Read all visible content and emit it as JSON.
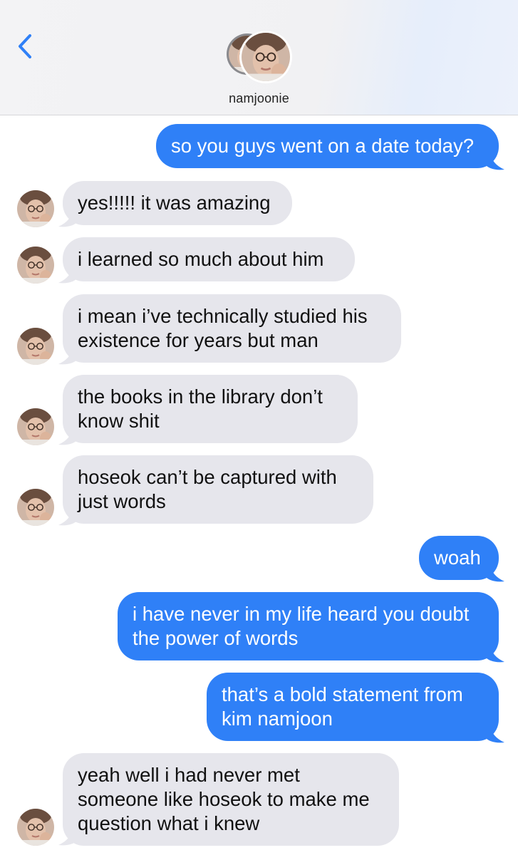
{
  "header": {
    "contact_name": "namjoonie",
    "back_icon": "chevron-left-icon",
    "accent_color": "#2f80f7"
  },
  "messages": [
    {
      "side": "sent",
      "text": "so you guys went on a date today?"
    },
    {
      "side": "received",
      "text": "yes!!!!! it was amazing"
    },
    {
      "side": "received",
      "text": "i learned so much about him"
    },
    {
      "side": "received",
      "lines": [
        "i mean i’ve technically studied his",
        "existence for years but man"
      ]
    },
    {
      "side": "received",
      "lines": [
        "the books in the library don’t",
        "know shit"
      ]
    },
    {
      "side": "received",
      "lines": [
        "hoseok can’t be captured with",
        "just words"
      ]
    },
    {
      "side": "sent",
      "text": "woah"
    },
    {
      "side": "sent",
      "lines": [
        "i have never in my life heard you doubt",
        "the power of words"
      ]
    },
    {
      "side": "sent",
      "lines": [
        "that’s a bold statement from",
        "kim namjoon"
      ]
    },
    {
      "side": "received",
      "lines": [
        "yeah well i had never met",
        "someone like hoseok to make me",
        "question what i knew"
      ]
    }
  ],
  "colors": {
    "sent_bubble": "#2f80f7",
    "received_bubble": "#e6e6ec"
  }
}
